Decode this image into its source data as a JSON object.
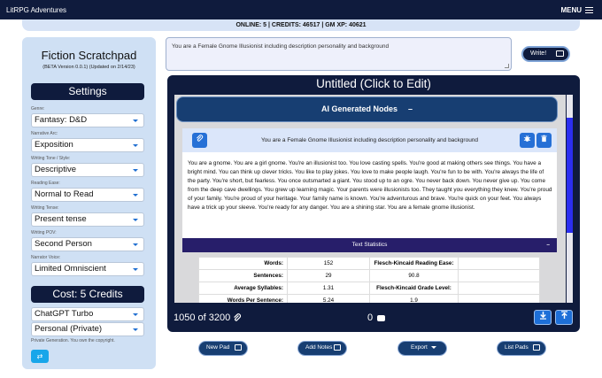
{
  "app": {
    "brand": "LitRPG Adventures",
    "menu_label": "MENU"
  },
  "status": {
    "text": "ONLINE: 5 | CREDITS: 46517 | GM XP: 40621"
  },
  "sidebar": {
    "title": "Fiction Scratchpad",
    "subtitle": "(BETA Version 0.0.1) (Updated on 2/14/23)",
    "settings_heading": "Settings",
    "fields": [
      {
        "label": "Genre:",
        "value": "Fantasy: D&D"
      },
      {
        "label": "Narrative Arc:",
        "value": "Exposition"
      },
      {
        "label": "Writing Tone / Style:",
        "value": "Descriptive"
      },
      {
        "label": "Reading Ease:",
        "value": "Normal to Read"
      },
      {
        "label": "Writing Tense:",
        "value": "Present tense"
      },
      {
        "label": "Writing POV:",
        "value": "Second Person"
      },
      {
        "label": "Narrator Voice:",
        "value": "Limited Omniscient"
      }
    ],
    "cost_heading": "Cost: 5 Credits",
    "model": "ChatGPT Turbo",
    "privacy": "Personal (Private)",
    "privacy_note": "Private Generation. You own the copyright.",
    "swap_icon": "⇄"
  },
  "prompt": {
    "value": "You are a Female Gnome Illusionist including description personality and background",
    "write_label": "Write!"
  },
  "document": {
    "title": "Untitled (Click to Edit)",
    "ai_nodes_heading": "AI Generated Nodes",
    "ai_nodes_toggle": "–",
    "node": {
      "prompt": "You are a Female Gnome Illusionist including description personality and background",
      "text": "You are a gnome. You are a girl gnome. You're an illusionist too. You love casting spells. You're good at making others see things. You have a bright mind. You can think up clever tricks. You like to play jokes. You love to make people laugh. You're fun to be with. You're always the life of the party. You're short, but fearless. You once outsmarted a giant. You stood up to an ogre. You never back down. You never give up. You come from the deep cave dwellings. You grew up learning magic. Your parents were illusionists too. They taught you everything they knew. You're proud of your family. You're proud of your heritage. Your family name is known. You're adventurous and brave. You're quick on your feet. You always have a trick up your sleeve. You're ready for any danger. You are a shining star. You are a female gnome illusionist."
    },
    "text_stats": {
      "heading": "Text Statistics",
      "toggle": "–",
      "rows": [
        {
          "k1": "Words:",
          "v1": "152",
          "k2": "Flesch-Kincaid Reading Ease:",
          "v2": ""
        },
        {
          "k1": "Sentences:",
          "v1": "29",
          "k2": "90.8",
          "v2": ""
        },
        {
          "k1": "Average Syllables:",
          "v1": "1.31",
          "k2": "Flesch-Kincaid Grade Level:",
          "v2": ""
        },
        {
          "k1": "Words Per Sentence:",
          "v1": "5.24",
          "k2": "1.9",
          "v2": ""
        }
      ]
    },
    "word_count": "1050 of 3200",
    "notes_count": "0"
  },
  "bottom_buttons": {
    "new_pad": "New Pad",
    "add_notes": "Add Notes",
    "export": "Export",
    "list_pads": "List Pads"
  },
  "colors": {
    "navy": "#0f1b3d",
    "accent_blue": "#2670d6",
    "scrollbar": "#2b2ef0"
  }
}
